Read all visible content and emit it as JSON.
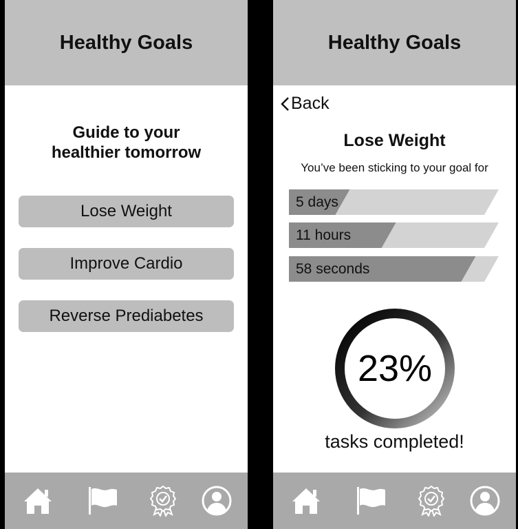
{
  "left_screen": {
    "header_title": "Healthy Goals",
    "guide_line1": "Guide to your",
    "guide_line2": "healthier tomorrow",
    "goals": [
      {
        "label": "Lose Weight"
      },
      {
        "label": "Improve Cardio"
      },
      {
        "label": "Reverse Prediabetes"
      }
    ]
  },
  "right_screen": {
    "header_title": "Healthy Goals",
    "back_label": "Back",
    "goal_title": "Lose Weight",
    "subtitle": "You’ve been sticking to your goal for",
    "streaks": [
      {
        "label": "5 days",
        "fill_fraction": 0.29
      },
      {
        "label": "11 hours",
        "fill_fraction": 0.51
      },
      {
        "label": "58 seconds",
        "fill_fraction": 0.89
      }
    ],
    "progress_percent_text": "23%",
    "tasks_label": "tasks completed!"
  },
  "nav_items": [
    {
      "icon": "home-icon"
    },
    {
      "icon": "flag-icon"
    },
    {
      "icon": "award-badge-icon"
    },
    {
      "icon": "profile-icon"
    }
  ],
  "colors": {
    "header_bg": "#bfbfbf",
    "nav_bg": "#a9a9a9",
    "button_bg": "#bdbdbd",
    "bar_track": "#d3d3d3",
    "bar_fill": "#8c8c8c"
  }
}
